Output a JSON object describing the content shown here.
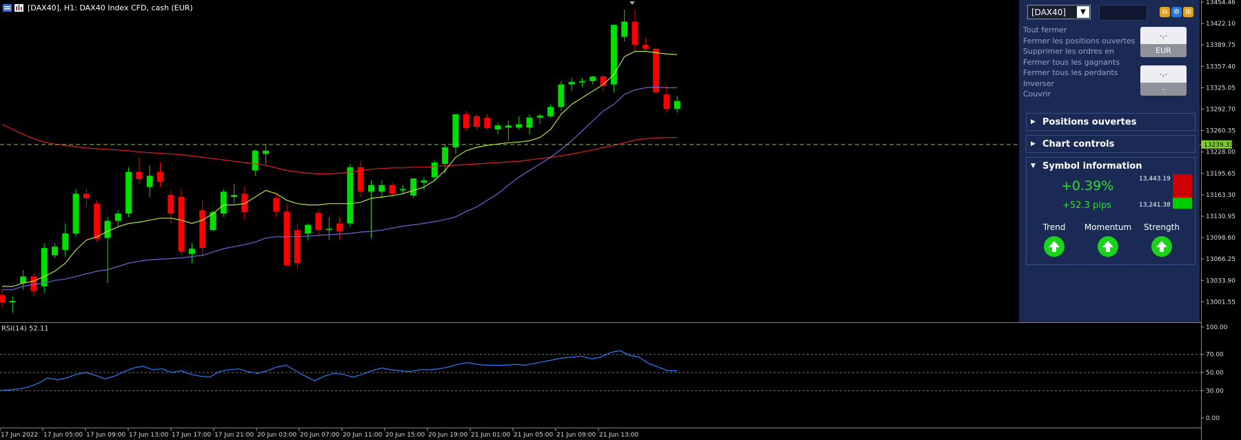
{
  "window": {
    "title": "[DAX40], H1:  DAX40 Index CFD, cash (EUR)"
  },
  "price_axis": {
    "labels": [
      "13454.46",
      "13422.10",
      "13389.75",
      "13357.40",
      "13325.05",
      "13292.70",
      "13260.35",
      "13228.00",
      "13195.65",
      "13163.30",
      "13130.95",
      "13098.60",
      "13066.25",
      "13033.90",
      "13001.55"
    ],
    "current_price": "13239.33"
  },
  "rsi": {
    "label": "RSI(14) 52.11",
    "axis_labels": [
      "100.00",
      "70.00",
      "50.00",
      "30.00",
      "0.00"
    ]
  },
  "time_axis": {
    "labels": [
      "17 Jun 2022",
      "17 Jun 05:00",
      "17 Jun 09:00",
      "17 Jun 13:00",
      "17 Jun 17:00",
      "17 Jun 21:00",
      "20 Jun 03:00",
      "20 Jun 07:00",
      "20 Jun 11:00",
      "20 Jun 15:00",
      "20 Jun 19:00",
      "21 Jun 01:00",
      "21 Jun 05:00",
      "21 Jun 09:00",
      "21 Jun 13:00"
    ]
  },
  "colors": {
    "bull": "#00e000",
    "bear": "#ff0000",
    "ma_fast": "#b8e832",
    "ma_mid": "#6a6ad8",
    "ma_slow": "#e02020",
    "rsi_line": "#2f7bff",
    "price_line": "#7fd12a"
  },
  "panel": {
    "symbol": "[DAX40]",
    "actions": [
      "Tout fermer",
      "Fermer les positions ouvertes",
      "Supprimer les ordres en",
      "Fermer tous les gagnants",
      "Fermer tous les perdants",
      "Inverser",
      "Couvrir"
    ],
    "value_button_1": {
      "value": "-,-",
      "caption": "EUR"
    },
    "value_button_2": {
      "value": "-,-",
      "caption": "-"
    },
    "sections": {
      "open_positions": "Positions ouvertes",
      "chart_controls": "Chart controls",
      "symbol_info": "Symbol information"
    },
    "symbol_info": {
      "change_percent": "+0.39%",
      "change_pips": "+52.3 pips",
      "high": "13,443.19",
      "low": "13,241.38",
      "indicators": [
        {
          "label": "Trend",
          "icon": "arrow-up-icon",
          "direction": "up"
        },
        {
          "label": "Momentum",
          "icon": "arrow-up-icon",
          "direction": "up"
        },
        {
          "label": "Strength",
          "icon": "arrow-up-icon",
          "direction": "up"
        }
      ]
    }
  },
  "chart_data": {
    "type": "candlestick",
    "timeframe": "H1",
    "candles": [
      {
        "o": 13012,
        "h": 13020,
        "l": 12992,
        "c": 13001
      },
      {
        "o": 13001,
        "h": 13010,
        "l": 12985,
        "c": 13003
      },
      {
        "o": 13030,
        "h": 13050,
        "l": 13020,
        "c": 13040
      },
      {
        "o": 13040,
        "h": 13045,
        "l": 13010,
        "c": 13018
      },
      {
        "o": 13025,
        "h": 13090,
        "l": 13015,
        "c": 13083
      },
      {
        "o": 13072,
        "h": 13090,
        "l": 13068,
        "c": 13085
      },
      {
        "o": 13080,
        "h": 13120,
        "l": 13070,
        "c": 13105
      },
      {
        "o": 13105,
        "h": 13172,
        "l": 13100,
        "c": 13165
      },
      {
        "o": 13165,
        "h": 13172,
        "l": 13145,
        "c": 13158
      },
      {
        "o": 13150,
        "h": 13155,
        "l": 13092,
        "c": 13097
      },
      {
        "o": 13098,
        "h": 13130,
        "l": 13030,
        "c": 13124
      },
      {
        "o": 13124,
        "h": 13140,
        "l": 13115,
        "c": 13135
      },
      {
        "o": 13135,
        "h": 13205,
        "l": 13130,
        "c": 13198
      },
      {
        "o": 13198,
        "h": 13220,
        "l": 13180,
        "c": 13187
      },
      {
        "o": 13175,
        "h": 13208,
        "l": 13160,
        "c": 13192
      },
      {
        "o": 13198,
        "h": 13212,
        "l": 13175,
        "c": 13183
      },
      {
        "o": 13163,
        "h": 13170,
        "l": 13120,
        "c": 13135
      },
      {
        "o": 13160,
        "h": 13172,
        "l": 13072,
        "c": 13078
      },
      {
        "o": 13074,
        "h": 13090,
        "l": 13060,
        "c": 13082
      },
      {
        "o": 13140,
        "h": 13155,
        "l": 13070,
        "c": 13083
      },
      {
        "o": 13110,
        "h": 13140,
        "l": 13108,
        "c": 13137
      },
      {
        "o": 13135,
        "h": 13172,
        "l": 13130,
        "c": 13168
      },
      {
        "o": 13160,
        "h": 13180,
        "l": 13150,
        "c": 13163
      },
      {
        "o": 13165,
        "h": 13175,
        "l": 13125,
        "c": 13137
      },
      {
        "o": 13200,
        "h": 13232,
        "l": 13192,
        "c": 13230
      },
      {
        "o": 13225,
        "h": 13240,
        "l": 13210,
        "c": 13230
      },
      {
        "o": 13158,
        "h": 13165,
        "l": 13130,
        "c": 13138
      },
      {
        "o": 13138,
        "h": 13150,
        "l": 13055,
        "c": 13057
      },
      {
        "o": 13110,
        "h": 13120,
        "l": 13052,
        "c": 13060
      },
      {
        "o": 13105,
        "h": 13120,
        "l": 13095,
        "c": 13118
      },
      {
        "o": 13136,
        "h": 13140,
        "l": 13100,
        "c": 13110
      },
      {
        "o": 13110,
        "h": 13130,
        "l": 13095,
        "c": 13112
      },
      {
        "o": 13120,
        "h": 13130,
        "l": 13095,
        "c": 13108
      },
      {
        "o": 13120,
        "h": 13210,
        "l": 13115,
        "c": 13205
      },
      {
        "o": 13205,
        "h": 13215,
        "l": 13160,
        "c": 13168
      },
      {
        "o": 13168,
        "h": 13185,
        "l": 13098,
        "c": 13178
      },
      {
        "o": 13168,
        "h": 13185,
        "l": 13158,
        "c": 13178
      },
      {
        "o": 13178,
        "h": 13182,
        "l": 13160,
        "c": 13165
      },
      {
        "o": 13170,
        "h": 13178,
        "l": 13165,
        "c": 13172
      },
      {
        "o": 13162,
        "h": 13185,
        "l": 13158,
        "c": 13188
      },
      {
        "o": 13182,
        "h": 13190,
        "l": 13170,
        "c": 13185
      },
      {
        "o": 13190,
        "h": 13215,
        "l": 13185,
        "c": 13212
      },
      {
        "o": 13210,
        "h": 13240,
        "l": 13195,
        "c": 13235
      },
      {
        "o": 13235,
        "h": 13285,
        "l": 13225,
        "c": 13285
      },
      {
        "o": 13285,
        "h": 13290,
        "l": 13260,
        "c": 13264
      },
      {
        "o": 13282,
        "h": 13285,
        "l": 13262,
        "c": 13266
      },
      {
        "o": 13280,
        "h": 13285,
        "l": 13262,
        "c": 13264
      },
      {
        "o": 13262,
        "h": 13272,
        "l": 13255,
        "c": 13268
      },
      {
        "o": 13265,
        "h": 13275,
        "l": 13245,
        "c": 13268
      },
      {
        "o": 13265,
        "h": 13282,
        "l": 13262,
        "c": 13270
      },
      {
        "o": 13265,
        "h": 13285,
        "l": 13255,
        "c": 13280
      },
      {
        "o": 13280,
        "h": 13285,
        "l": 13270,
        "c": 13283
      },
      {
        "o": 13282,
        "h": 13300,
        "l": 13280,
        "c": 13296
      },
      {
        "o": 13296,
        "h": 13335,
        "l": 13290,
        "c": 13330
      },
      {
        "o": 13330,
        "h": 13340,
        "l": 13320,
        "c": 13334
      },
      {
        "o": 13333,
        "h": 13340,
        "l": 13326,
        "c": 13335
      },
      {
        "o": 13335,
        "h": 13343,
        "l": 13330,
        "c": 13342
      },
      {
        "o": 13342,
        "h": 13345,
        "l": 13320,
        "c": 13328
      },
      {
        "o": 13330,
        "h": 13420,
        "l": 13318,
        "c": 13420
      },
      {
        "o": 13402,
        "h": 13443,
        "l": 13395,
        "c": 13425
      },
      {
        "o": 13425,
        "h": 13443,
        "l": 13380,
        "c": 13390
      },
      {
        "o": 13390,
        "h": 13400,
        "l": 13380,
        "c": 13384
      },
      {
        "o": 13384,
        "h": 13384,
        "l": 13315,
        "c": 13318
      },
      {
        "o": 13315,
        "h": 13330,
        "l": 13288,
        "c": 13293
      },
      {
        "o": 13293,
        "h": 13312,
        "l": 13288,
        "c": 13305
      }
    ],
    "ma_fast": [
      13025,
      13025,
      13030,
      13033,
      13040,
      13048,
      13060,
      13080,
      13095,
      13100,
      13108,
      13115,
      13120,
      13122,
      13125,
      13128,
      13128,
      13125,
      13120,
      13125,
      13135,
      13148,
      13148,
      13150,
      13160,
      13170,
      13165,
      13155,
      13150,
      13148,
      13148,
      13150,
      13150,
      13150,
      13152,
      13158,
      13160,
      13162,
      13165,
      13170,
      13175,
      13185,
      13200,
      13220,
      13230,
      13235,
      13238,
      13240,
      13242,
      13243,
      13245,
      13250,
      13262,
      13285,
      13300,
      13310,
      13320,
      13330,
      13345,
      13372,
      13380,
      13380,
      13378,
      13376,
      13375
    ],
    "ma_mid": [
      13020,
      13020,
      13025,
      13028,
      13030,
      13034,
      13036,
      13040,
      13044,
      13048,
      13050,
      13055,
      13060,
      13063,
      13065,
      13066,
      13067,
      13068,
      13070,
      13072,
      13077,
      13082,
      13085,
      13088,
      13092,
      13098,
      13100,
      13100,
      13100,
      13101,
      13102,
      13103,
      13104,
      13105,
      13107,
      13108,
      13110,
      13113,
      13116,
      13118,
      13120,
      13123,
      13126,
      13130,
      13138,
      13145,
      13155,
      13165,
      13178,
      13190,
      13200,
      13210,
      13220,
      13232,
      13245,
      13260,
      13275,
      13290,
      13300,
      13315,
      13322,
      13325,
      13326,
      13325,
      13325
    ],
    "ma_slow": [
      13270,
      13262,
      13255,
      13248,
      13243,
      13240,
      13238,
      13236,
      13234,
      13233,
      13232,
      13231,
      13230,
      13228,
      13227,
      13226,
      13225,
      13224,
      13222,
      13220,
      13218,
      13216,
      13214,
      13212,
      13210,
      13208,
      13204,
      13200,
      13198,
      13196,
      13195,
      13195,
      13196,
      13198,
      13200,
      13202,
      13203,
      13204,
      13204,
      13205,
      13205,
      13206,
      13207,
      13208,
      13209,
      13210,
      13211,
      13212,
      13213,
      13214,
      13216,
      13218,
      13220,
      13222,
      13225,
      13228,
      13231,
      13235,
      13238,
      13242,
      13246,
      13248,
      13249,
      13250,
      13250
    ],
    "rsi_values": [
      30,
      31,
      32,
      34,
      38,
      44,
      42,
      44,
      48,
      50,
      47,
      43,
      46,
      51,
      55,
      57,
      53,
      54,
      50,
      52,
      48,
      46,
      45,
      51,
      53,
      54,
      51,
      49,
      52,
      56,
      58,
      52,
      46,
      41,
      46,
      49,
      48,
      45,
      48,
      52,
      55,
      53,
      52,
      51,
      53,
      53,
      54,
      56,
      59,
      61,
      59,
      58,
      58,
      58,
      59,
      58,
      60,
      62,
      64,
      66,
      67,
      68,
      65,
      67,
      72,
      74,
      69,
      67,
      60,
      56,
      52,
      52
    ],
    "y_range": [
      12985,
      13463
    ],
    "rsi_range": [
      0,
      100
    ]
  }
}
